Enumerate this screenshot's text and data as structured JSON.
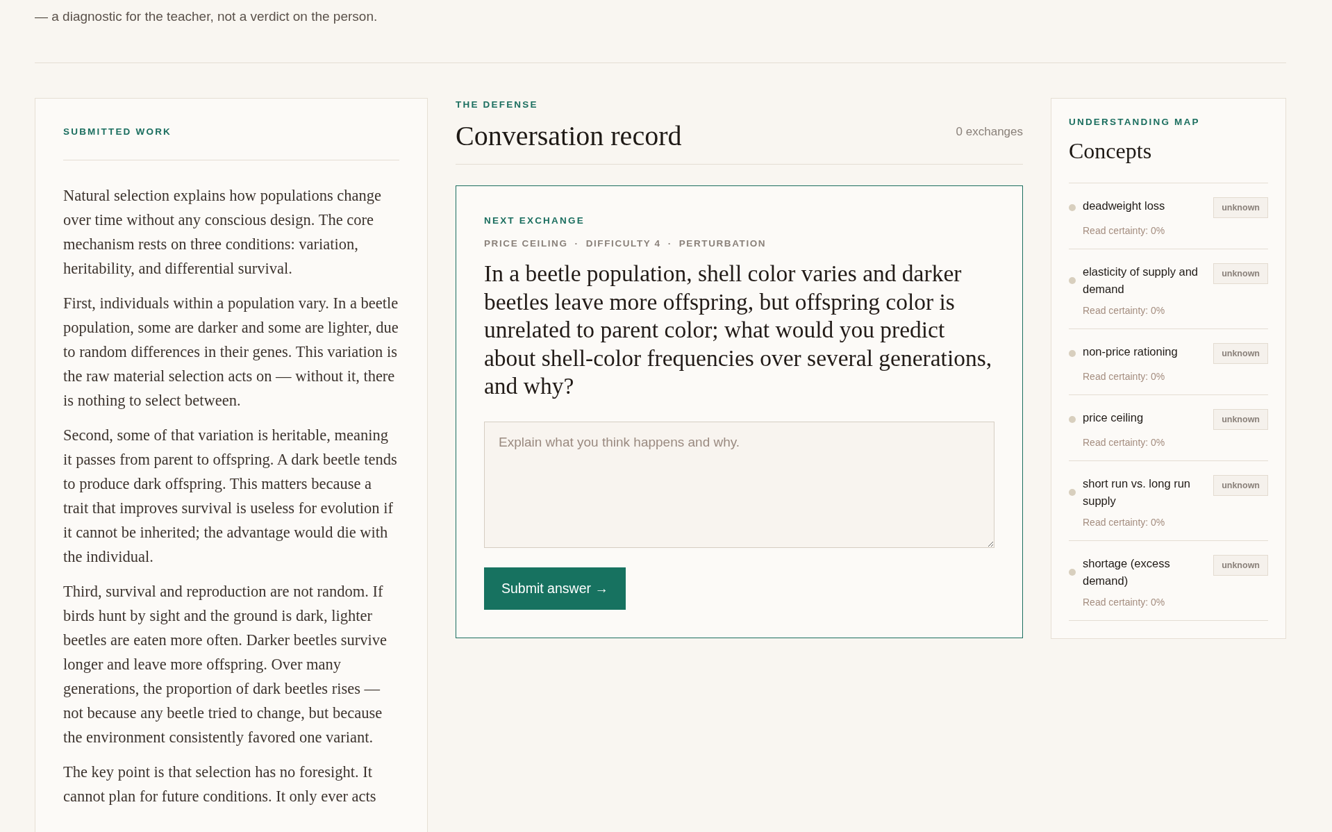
{
  "intro_tail": "— a diagnostic for the teacher, not a verdict on the person.",
  "submitted_work": {
    "label": "SUBMITTED WORK",
    "paragraphs": [
      "Natural selection explains how populations change over time without any conscious design. The core mechanism rests on three conditions: variation, heritability, and differential survival.",
      "First, individuals within a population vary. In a beetle population, some are darker and some are lighter, due to random differences in their genes. This variation is the raw material selection acts on — without it, there is nothing to select between.",
      "Second, some of that variation is heritable, meaning it passes from parent to offspring. A dark beetle tends to produce dark offspring. This matters because a trait that improves survival is useless for evolution if it cannot be inherited; the advantage would die with the individual.",
      "Third, survival and reproduction are not random. If birds hunt by sight and the ground is dark, lighter beetles are eaten more often. Darker beetles survive longer and leave more offspring. Over many generations, the proportion of dark beetles rises — not because any beetle tried to change, but because the environment consistently favored one variant.",
      "The key point is that selection has no foresight. It cannot plan for future conditions. It only ever acts"
    ]
  },
  "defense": {
    "eyebrow": "THE DEFENSE",
    "title": "Conversation record",
    "count": "0 exchanges",
    "next": {
      "label": "NEXT EXCHANGE",
      "meta": [
        "PRICE CEILING",
        "·",
        "DIFFICULTY 4",
        "·",
        "PERTURBATION"
      ],
      "question": "In a beetle population, shell color varies and darker beetles leave more offspring, but offspring color is unrelated to parent color; what would you predict about shell-color frequencies over several generations, and why?",
      "answer": {
        "placeholder": "Explain what you think happens and why."
      },
      "submit": "Submit answer →"
    }
  },
  "map": {
    "eyebrow": "UNDERSTANDING MAP",
    "title": "Concepts",
    "concepts": [
      {
        "name": "deadweight loss",
        "status": "unknown",
        "certainty": "Read certainty: 0%",
        "color": "#d8cfbe"
      },
      {
        "name": "elasticity of supply and demand",
        "status": "unknown",
        "certainty": "Read certainty: 0%",
        "color": "#d8cfbe"
      },
      {
        "name": "non-price rationing",
        "status": "unknown",
        "certainty": "Read certainty: 0%",
        "color": "#d8cfbe"
      },
      {
        "name": "price ceiling",
        "status": "unknown",
        "certainty": "Read certainty: 0%",
        "color": "#d8cfbe"
      },
      {
        "name": "short run vs. long run supply",
        "status": "unknown",
        "certainty": "Read certainty: 0%",
        "color": "#d8cfbe"
      },
      {
        "name": "shortage (excess demand)",
        "status": "unknown",
        "certainty": "Read certainty: 0%",
        "color": "#d8cfbe"
      }
    ]
  }
}
